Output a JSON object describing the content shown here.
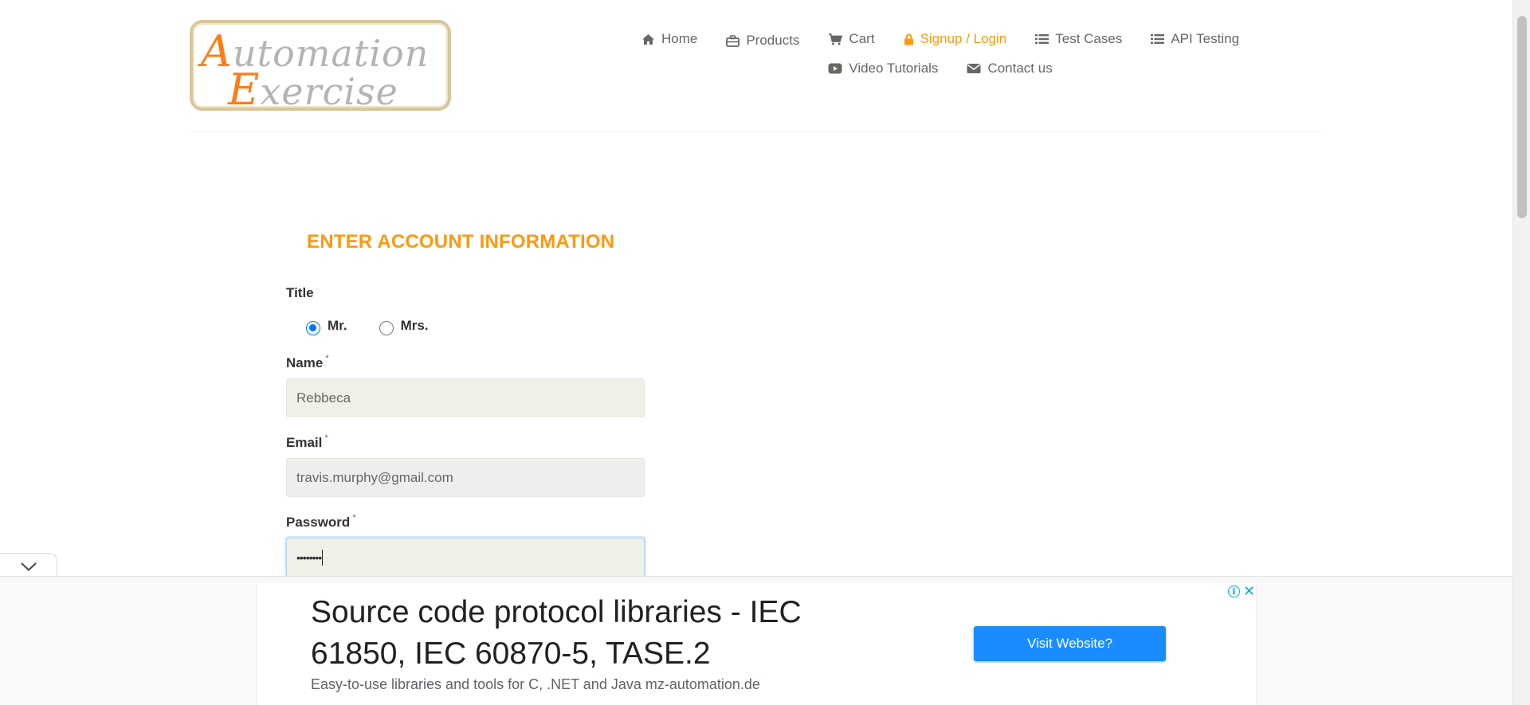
{
  "header": {
    "logo": {
      "line1_cap": "A",
      "line1_rest": "utomation",
      "line2_cap": "E",
      "line2_rest": "xercise"
    },
    "nav_row1": [
      {
        "label": "Home",
        "icon": "home-icon",
        "active": false
      },
      {
        "label": "Products",
        "icon": "briefcase-icon",
        "active": false
      },
      {
        "label": "Cart",
        "icon": "cart-icon",
        "active": false
      },
      {
        "label": "Signup / Login",
        "icon": "lock-icon",
        "active": true
      },
      {
        "label": "Test Cases",
        "icon": "list-icon",
        "active": false
      },
      {
        "label": "API Testing",
        "icon": "list-icon",
        "active": false
      }
    ],
    "nav_row2": [
      {
        "label": "Video Tutorials",
        "icon": "youtube-play-icon",
        "active": false
      },
      {
        "label": "Contact us",
        "icon": "envelope-icon",
        "active": false
      }
    ]
  },
  "form": {
    "heading": "ENTER ACCOUNT INFORMATION",
    "title_label": "Title",
    "title_options": [
      {
        "label": "Mr.",
        "checked": true
      },
      {
        "label": "Mrs.",
        "checked": false
      }
    ],
    "name_label": "Name",
    "name_value": "Rebbeca",
    "email_label": "Email",
    "email_value": "travis.murphy@gmail.com",
    "password_label": "Password",
    "password_masked": "••••••••",
    "required_mark": "*"
  },
  "ad": {
    "headline": "Source code protocol libraries - IEC 61850, IEC 60870-5, TASE.2",
    "description": "Easy-to-use libraries and tools for C, .NET and Java mz-automation.de",
    "button_label": "Visit Website?",
    "info_glyph": "i",
    "close_glyph": "✕"
  },
  "colors": {
    "accent": "#fe980f",
    "text": "#696763",
    "input_bg": "#f0f0e9",
    "ad_button": "#1a8cff",
    "radio_checked": "#0075ff"
  }
}
